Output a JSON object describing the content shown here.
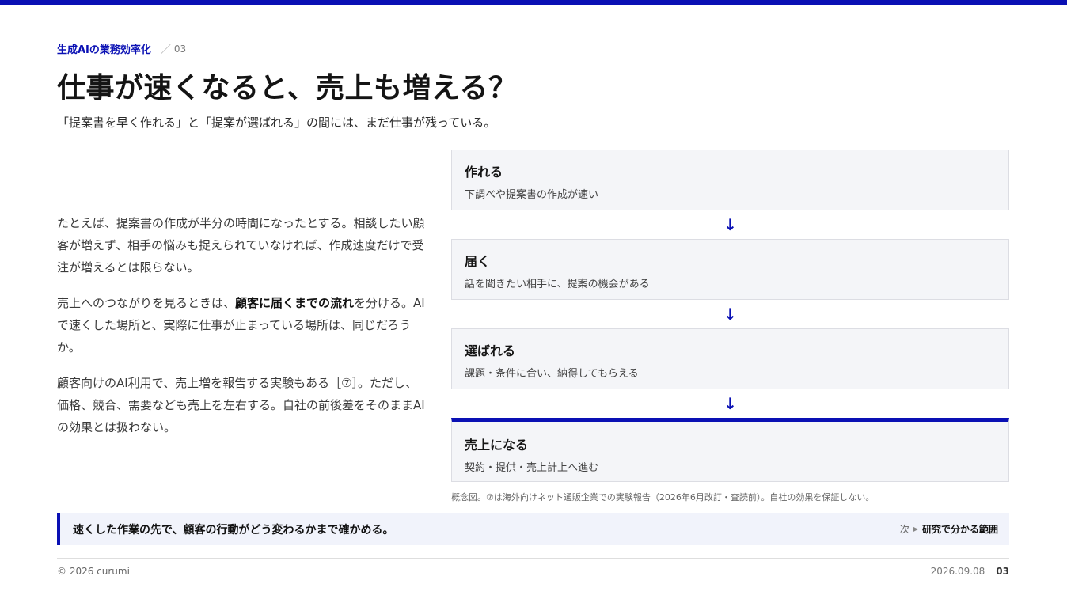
{
  "header": {
    "section": "生成AIの業務効率化",
    "slash": "／",
    "number": "03"
  },
  "title": "仕事が速くなると、売上も増える？",
  "subtitle": "「提案書を早く作れる」と「提案が選ばれる」の間には、まだ仕事が残っている。",
  "body": {
    "p1": "たとえば、提案書の作成が半分の時間になったとする。相談したい顧客が増えず、相手の悩みも捉えられていなければ、作成速度だけで受注が増えるとは限らない。",
    "p2_pre": "売上へのつながりを見るときは、",
    "p2_bold": "顧客に届くまでの流れ",
    "p2_post": "を分ける。AIで速くした場所と、実際に仕事が止まっている場所は、同じだろうか。",
    "p3": "顧客向けのAI利用で、売上増を報告する実験もある［⑦］。ただし、価格、競合、需要なども売上を左右する。自社の前後差をそのままAIの効果とは扱わない。"
  },
  "flow": {
    "arrow": "↓",
    "steps": [
      {
        "name": "作れる",
        "desc": "下調べや提案書の作成が速い"
      },
      {
        "name": "届く",
        "desc": "話を聞きたい相手に、提案の機会がある"
      },
      {
        "name": "選ばれる",
        "desc": "課題・条件に合い、納得してもらえる"
      },
      {
        "name": "売上になる",
        "desc": "契約・提供・売上計上へ進む"
      }
    ]
  },
  "caption": "概念図。⑦は海外向けネット通販企業での実験報告（2026年6月改訂・査読前）。自社の効果を保証しない。",
  "callout": {
    "message": "速くした作業の先で、顧客の行動がどう変わるかまで確かめる。",
    "next_label": "次",
    "next_target": "研究で分かる範囲"
  },
  "footer": {
    "copyright": "© 2026 curumi",
    "date": "2026.09.08",
    "page": "03"
  },
  "colors": {
    "accent": "#0a10b4",
    "box_bg": "#f4f5f8",
    "callout_bg": "#f1f3fb"
  }
}
